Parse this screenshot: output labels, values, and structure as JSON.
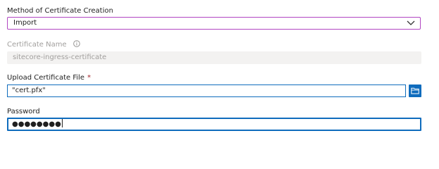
{
  "method": {
    "label": "Method of Certificate Creation",
    "selected": "Import"
  },
  "certificate_name": {
    "label": "Certificate Name",
    "value": "sitecore-ingress-certificate"
  },
  "upload": {
    "label": "Upload Certificate File",
    "required_marker": "*",
    "value": "\"cert.pfx\""
  },
  "password": {
    "label": "Password",
    "value": "●●●●●●●●"
  },
  "colors": {
    "focus_purple": "#b146c2",
    "accent_blue": "#0f6cbd",
    "required_red": "#a4262c",
    "disabled_bg": "#f3f2f1",
    "disabled_text": "#a19f9d"
  },
  "icons": {
    "dropdown": "chevron-down-icon",
    "info": "info-icon",
    "browse": "folder-icon"
  }
}
